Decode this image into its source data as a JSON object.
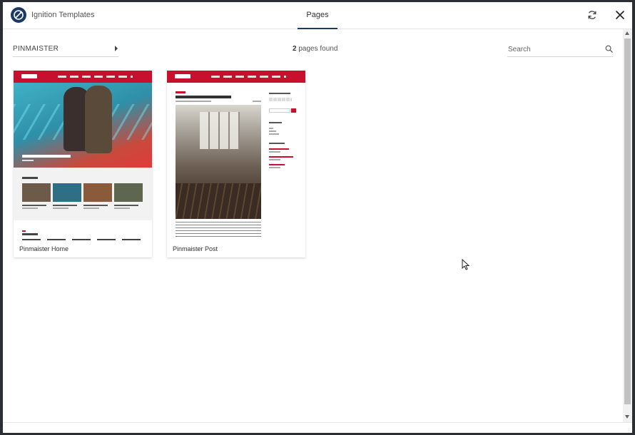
{
  "app": {
    "title": "Ignition Templates"
  },
  "header": {
    "tabs": [
      {
        "label": "Pages",
        "active": true
      }
    ],
    "icons": {
      "logo": "ignition-logo-icon",
      "refresh": "refresh-icon",
      "close": "close-icon"
    }
  },
  "filters": {
    "category": "PINMAISTER",
    "count": "2",
    "count_suffix": " pages found",
    "search_placeholder": "Search",
    "search_value": ""
  },
  "templates": [
    {
      "label": "Pinmaister Home"
    },
    {
      "label": "Pinmaister Post"
    }
  ],
  "colors": {
    "accent": "#1b3a66",
    "brand_red": "#c8102e",
    "scrollbar_thumb": "#c1c1c1"
  }
}
